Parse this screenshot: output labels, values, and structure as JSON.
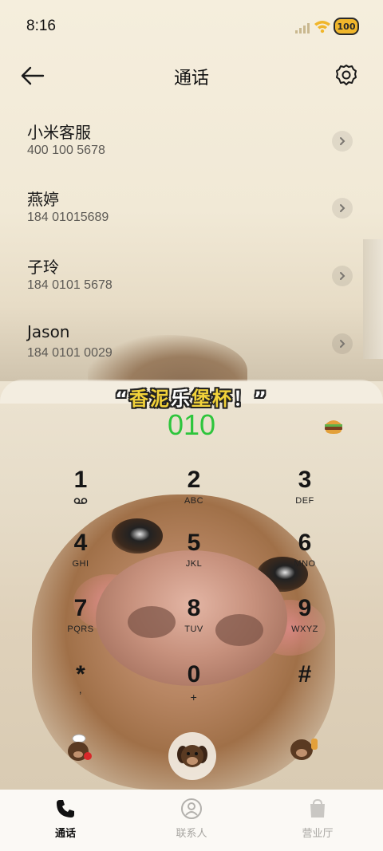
{
  "status_bar": {
    "time": "8:16",
    "battery": "100"
  },
  "header": {
    "title": "通话"
  },
  "recent_calls": [
    {
      "name": "小米客服",
      "number": "400 100 5678"
    },
    {
      "name": "燕婷",
      "number": "184 01015689"
    },
    {
      "name": "子玲",
      "number": "184 0101 5678"
    },
    {
      "name": "Jason",
      "number": "184 0101 0029"
    }
  ],
  "dialer": {
    "banner_open": "“",
    "banner_part1": "香泥",
    "banner_part2": "乐",
    "banner_part3": "堡杯",
    "banner_close": "！”",
    "dialed": "010",
    "keys": [
      {
        "digit": "1",
        "letters": ""
      },
      {
        "digit": "2",
        "letters": "ABC"
      },
      {
        "digit": "3",
        "letters": "DEF"
      },
      {
        "digit": "4",
        "letters": "GHI"
      },
      {
        "digit": "5",
        "letters": "JKL"
      },
      {
        "digit": "6",
        "letters": "MNO"
      },
      {
        "digit": "7",
        "letters": "PQRS"
      },
      {
        "digit": "8",
        "letters": "TUV"
      },
      {
        "digit": "9",
        "letters": "WXYZ"
      },
      {
        "digit": "*",
        "letters": ","
      },
      {
        "digit": "0",
        "letters": "+"
      },
      {
        "digit": "#",
        "letters": ""
      }
    ]
  },
  "bottom_nav": [
    {
      "label": "通话",
      "icon": "phone-icon",
      "active": true
    },
    {
      "label": "联系人",
      "icon": "contact-icon",
      "active": false
    },
    {
      "label": "营业厅",
      "icon": "store-bag-icon",
      "active": false
    }
  ],
  "colors": {
    "dialed_number": "#2ec53c",
    "battery": "#f0b62b"
  }
}
